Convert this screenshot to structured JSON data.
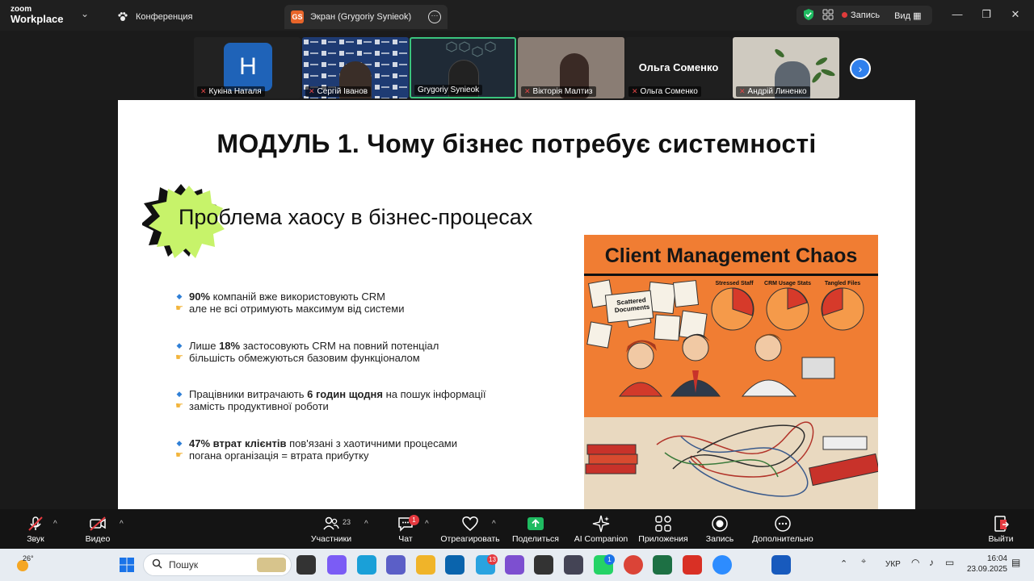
{
  "app": {
    "logo_top": "zoom",
    "logo_bottom": "Workplace"
  },
  "tabs": [
    {
      "label": "Конференция",
      "icon": "paw-icon"
    },
    {
      "label": "Экран (Grygoriy Synieok)",
      "badge": "GS",
      "icon": "more-icon"
    }
  ],
  "title_controls": {
    "record": "Запись",
    "view": "Вид"
  },
  "participants_strip": [
    {
      "name": "Кукіна Наталя",
      "muted": true,
      "avatar_letter": "H"
    },
    {
      "name": "Сергій Іванов",
      "muted": true
    },
    {
      "name": "Grygoriy Synieok",
      "muted": false,
      "active": true
    },
    {
      "name": "Вікторія Малтиз",
      "muted": true
    },
    {
      "name": "Ольга Соменко",
      "muted": true,
      "display_name": "Ольга Соменко"
    },
    {
      "name": "Андрій Линенко",
      "muted": true
    }
  ],
  "slide": {
    "title": "МОДУЛЬ 1. Чому бізнес потребує системності",
    "subtitle": "Проблема хаосу в бізнес-процесах",
    "bullets": [
      {
        "main_bold": "90%",
        "main_rest": " компаній вже використовують CRM",
        "sub": "але не всі отримують максимум від системи"
      },
      {
        "main_pre": "Лише ",
        "main_bold": "18%",
        "main_rest": " застосовують CRM на повний потенціал",
        "sub": "більшість обмежуються базовим функціоналом"
      },
      {
        "main_pre": "Працівники витрачають ",
        "main_bold": "6 годин щодня",
        "main_rest": " на пошук інформації",
        "sub": "замість продуктивної роботи"
      },
      {
        "main_bold": "47% втрат клієнтів",
        "main_rest": " пов'язані з хаотичними процесами",
        "sub": "погана організація = втрата прибутку"
      }
    ],
    "illustration": {
      "title": "Client Management Chaos",
      "note_label": "Scattered Documents",
      "chart_labels": [
        "Stressed Staff",
        "CRM Usage Stats",
        "Tangled Files"
      ]
    }
  },
  "toolbar": {
    "audio": "Звук",
    "video": "Видео",
    "participants": "Участники",
    "participants_count": "23",
    "chat": "Чат",
    "chat_badge": "1",
    "react": "Отреагировать",
    "share": "Поделиться",
    "ai": "AI Companion",
    "apps": "Приложения",
    "record": "Запись",
    "more": "Дополнительно",
    "leave": "Выйти"
  },
  "taskbar": {
    "weather": "26°",
    "search_placeholder": "Пошук",
    "lang": "УКР",
    "time": "16:04",
    "date": "23.09.2025",
    "telegram_badge": "13",
    "whatsapp_badge": "1"
  },
  "colors": {
    "zoom_blue": "#2f80ed",
    "share_green": "#1fbb61",
    "record_red": "#e03b3b",
    "active_border": "#3ac47d",
    "art_orange": "#f07d33",
    "burst_green": "#c7f36a"
  }
}
